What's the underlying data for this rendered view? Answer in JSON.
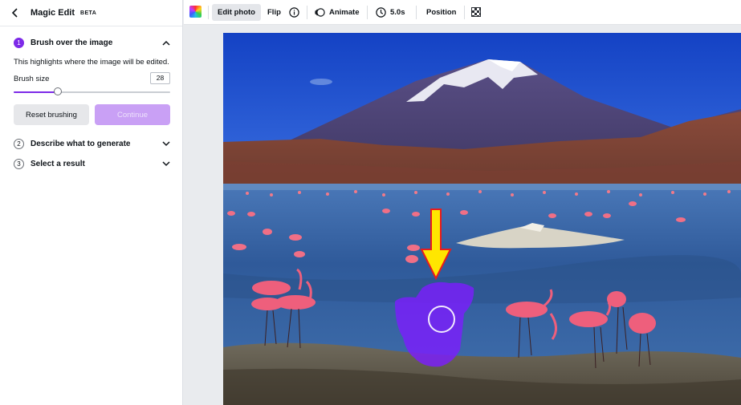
{
  "panel": {
    "title": "Magic Edit",
    "badge": "BETA",
    "steps": [
      {
        "number": "1",
        "label": "Brush over the image",
        "expanded": true
      },
      {
        "number": "2",
        "label": "Describe what to generate",
        "expanded": false
      },
      {
        "number": "3",
        "label": "Select a result",
        "expanded": false
      }
    ],
    "hint": "This highlights where the image will be edited.",
    "brush_size_label": "Brush size",
    "brush_size_value": "28",
    "brush_size_fraction": 0.28,
    "reset_button": "Reset brushing",
    "continue_button": "Continue"
  },
  "toolbar": {
    "edit_photo": "Edit photo",
    "flip": "Flip",
    "animate": "Animate",
    "duration": "5.0s",
    "position": "Position"
  },
  "colors": {
    "accent": "#7d2ae8",
    "continue_disabled": "#c9a0f5",
    "brush_overlay": "#7b1dfc",
    "arrow": "#ffe600"
  },
  "icons": [
    "back-arrow-icon",
    "chevron-up-icon",
    "chevron-down-icon",
    "color-palette-icon",
    "info-icon",
    "animate-icon",
    "timer-icon",
    "transparency-icon"
  ]
}
